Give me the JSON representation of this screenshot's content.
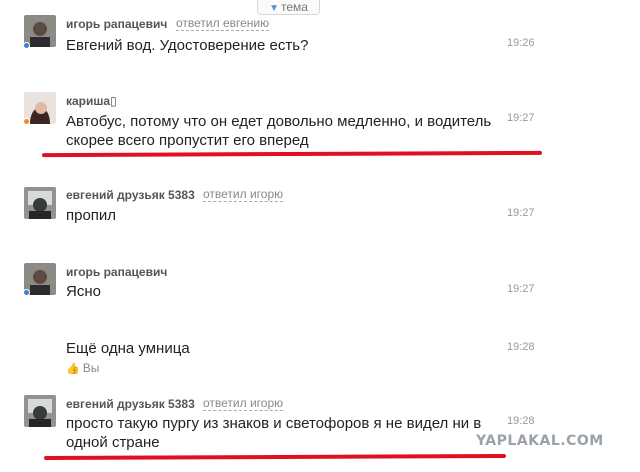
{
  "topic_tab": {
    "arrow": "▼",
    "label": "тема"
  },
  "messages": [
    {
      "author": "игорь рапацевич",
      "reply_to": "ответил евгению",
      "text": [
        "Евгений вод. Удостоверение есть?"
      ],
      "time": "19:26"
    },
    {
      "author": "кариша",
      "emoji": "▯",
      "reply_to": "",
      "text": [
        "Автобус, потому что он едет довольно медленно, и водитель",
        "скорее всего пропустит его вперед"
      ],
      "time": "19:27"
    },
    {
      "author": "евгений друзьяк 5383",
      "reply_to": "ответил игорю",
      "text": [
        "пропил"
      ],
      "time": "19:27"
    },
    {
      "author": "игорь рапацевич",
      "reply_to": "",
      "text": [
        "Ясно"
      ],
      "time": "19:27"
    },
    {
      "author": "",
      "reply_to": "",
      "text": [
        "Ещё одна умница"
      ],
      "time": "19:28",
      "like_label": "Вы"
    },
    {
      "author": "евгений друзьяк 5383",
      "reply_to": "ответил игорю",
      "text": [
        "просто такую пургу из знаков и светофоров  я не видел ни в",
        "одной стране"
      ],
      "time": "19:28"
    }
  ],
  "watermark": "YAPLAKAL.COM",
  "colors": {
    "accent": "#3f7fcf",
    "highlight": "#e0101e",
    "presence_orange": "#f28b25"
  }
}
